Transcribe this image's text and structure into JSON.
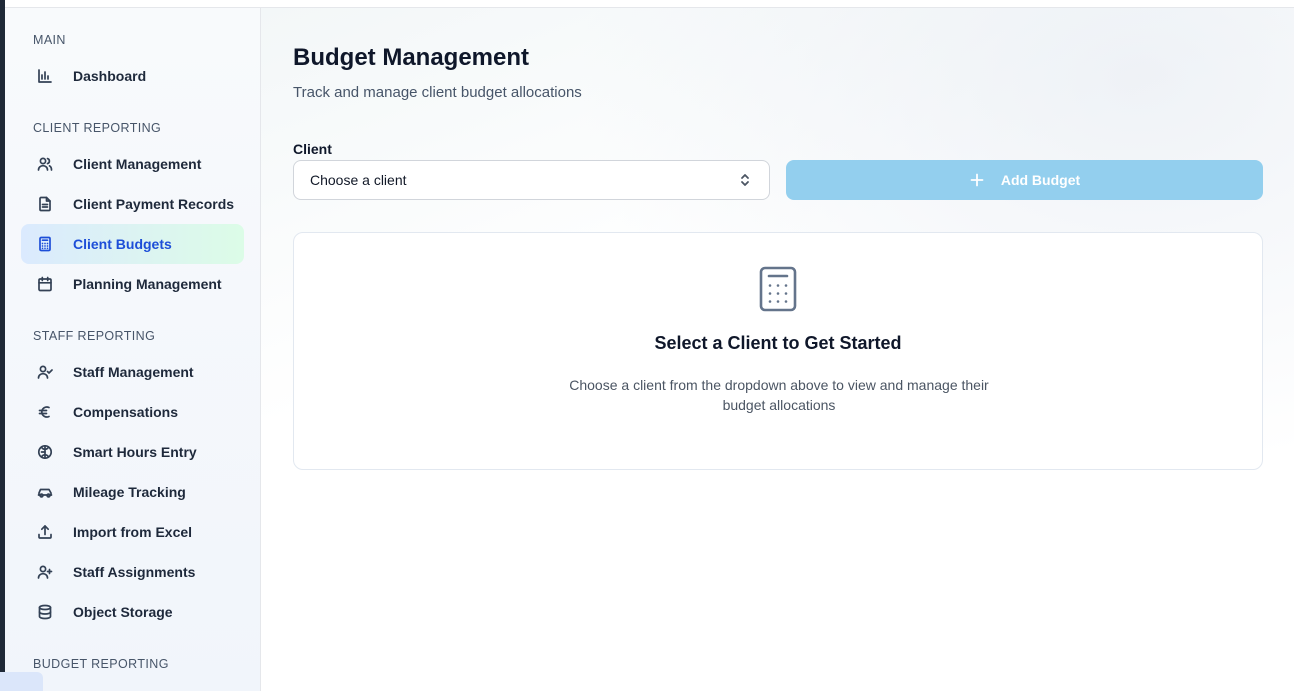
{
  "sidebar": {
    "sections": {
      "main": "MAIN",
      "client_reporting": "CLIENT REPORTING",
      "staff_reporting": "STAFF REPORTING",
      "budget_reporting": "BUDGET REPORTING"
    },
    "items": [
      {
        "label": "Dashboard",
        "icon": "bar-chart-icon"
      },
      {
        "label": "Client Management",
        "icon": "users-icon"
      },
      {
        "label": "Client Payment Records",
        "icon": "file-text-icon"
      },
      {
        "label": "Client Budgets",
        "icon": "calculator-icon",
        "active": true
      },
      {
        "label": "Planning Management",
        "icon": "calendar-icon"
      },
      {
        "label": "Staff Management",
        "icon": "user-check-icon"
      },
      {
        "label": "Compensations",
        "icon": "euro-icon"
      },
      {
        "label": "Smart Hours Entry",
        "icon": "brain-icon"
      },
      {
        "label": "Mileage Tracking",
        "icon": "car-icon"
      },
      {
        "label": "Import from Excel",
        "icon": "upload-icon"
      },
      {
        "label": "Staff Assignments",
        "icon": "user-plus-icon"
      },
      {
        "label": "Object Storage",
        "icon": "database-icon"
      }
    ]
  },
  "main": {
    "title": "Budget Management",
    "subtitle": "Track and manage client budget allocations",
    "client_label": "Client",
    "client_select_value": "Choose a client",
    "add_button_label": "Add Budget",
    "empty_state": {
      "icon": "calculator-icon",
      "title": "Select a Client to Get Started",
      "description": "Choose a client from the dropdown above to view and manage their budget allocations"
    }
  },
  "colors": {
    "accent": "#1d4ed8",
    "add_button_bg": "#93cfee",
    "active_item_gradient_start": "#dbeafe",
    "active_item_gradient_end": "#dcfce7"
  }
}
